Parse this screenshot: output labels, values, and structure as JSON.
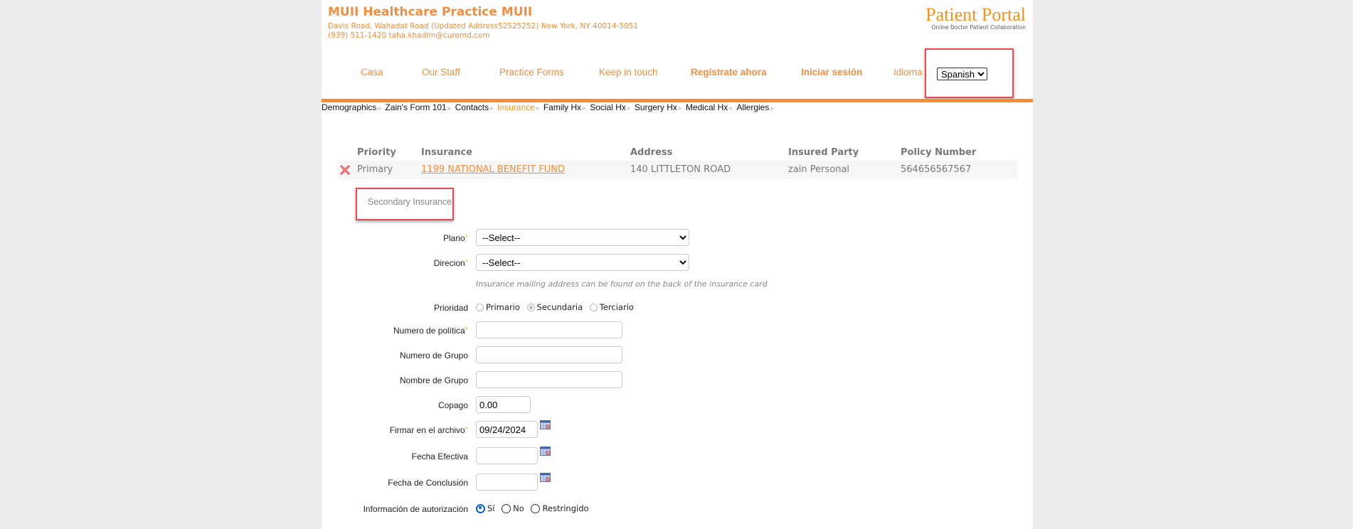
{
  "header": {
    "practice_name": "MUII Healthcare Practice MUII",
    "address_line": "Davis Road, Wahadat Road (Updated Address52525252) New York, NY 40014-5051",
    "contact_line": "(939) 511-1420 taha.khadim@curemd.com",
    "portal_title": "Patient Portal",
    "portal_subtitle": "Online Doctor Patient Collaboration"
  },
  "nav": {
    "items": [
      {
        "label": "Casa"
      },
      {
        "label": "Our Staff"
      },
      {
        "label": "Practice Forms"
      },
      {
        "label": "Keep in touch"
      },
      {
        "label": "Regístrate ahora"
      },
      {
        "label": "Iniciar sesión"
      }
    ],
    "language_label": "Idioma :",
    "language_selected": "Spanish"
  },
  "breadcrumbs": [
    {
      "label": "Demographics",
      "active": false
    },
    {
      "label": "Zain's Form 101",
      "active": false
    },
    {
      "label": "Contacts",
      "active": false
    },
    {
      "label": "Insurance",
      "active": true
    },
    {
      "label": "Family Hx",
      "active": false
    },
    {
      "label": "Social Hx",
      "active": false
    },
    {
      "label": "Surgery Hx",
      "active": false
    },
    {
      "label": "Medical Hx",
      "active": false
    },
    {
      "label": "Allergies",
      "active": false
    }
  ],
  "insurance_table": {
    "columns": [
      "Priority",
      "Insurance",
      "Address",
      "Insured Party",
      "Policy Number"
    ],
    "rows": [
      {
        "priority": "Primary",
        "insurance": "1199 NATIONAL BENEFIT FUND",
        "address": "140 LITTLETON ROAD",
        "insured_party": "zain Personal",
        "policy_number": "564656567567"
      }
    ]
  },
  "form": {
    "section_title": "Secondary Insurance",
    "plan_label": "Plano",
    "plan_value": "--Select--",
    "address_label": "Direcion",
    "address_value": "--Select--",
    "address_hint": "Insurance mailing address can be found on the back of the insurance card",
    "priority_label": "Prioridad",
    "priority_options": [
      "Primario",
      "Secundaria",
      "Terciario"
    ],
    "priority_selected": "Secundaria",
    "policy_number_label": "Numero de política",
    "policy_number_value": "",
    "group_number_label": "Numero de Grupo",
    "group_number_value": "",
    "group_name_label": "Nombre de Grupo",
    "group_name_value": "",
    "copay_label": "Copago",
    "copay_value": "0.00",
    "signature_label": "Firmar en el archivo",
    "signature_value": "09/24/2024",
    "effective_label": "Fecha Efectiva",
    "effective_value": "",
    "end_label": "Fecha de Conclusión",
    "end_value": "",
    "auth_label": "Información de autorización",
    "auth_options": [
      "Sí",
      "No",
      "Restringido"
    ],
    "auth_selected": "Sí",
    "required_marker": "*"
  },
  "colors": {
    "brand_orange": "#f48e3b",
    "bar_orange": "#f98b30",
    "highlight_red": "#ea4a52"
  }
}
